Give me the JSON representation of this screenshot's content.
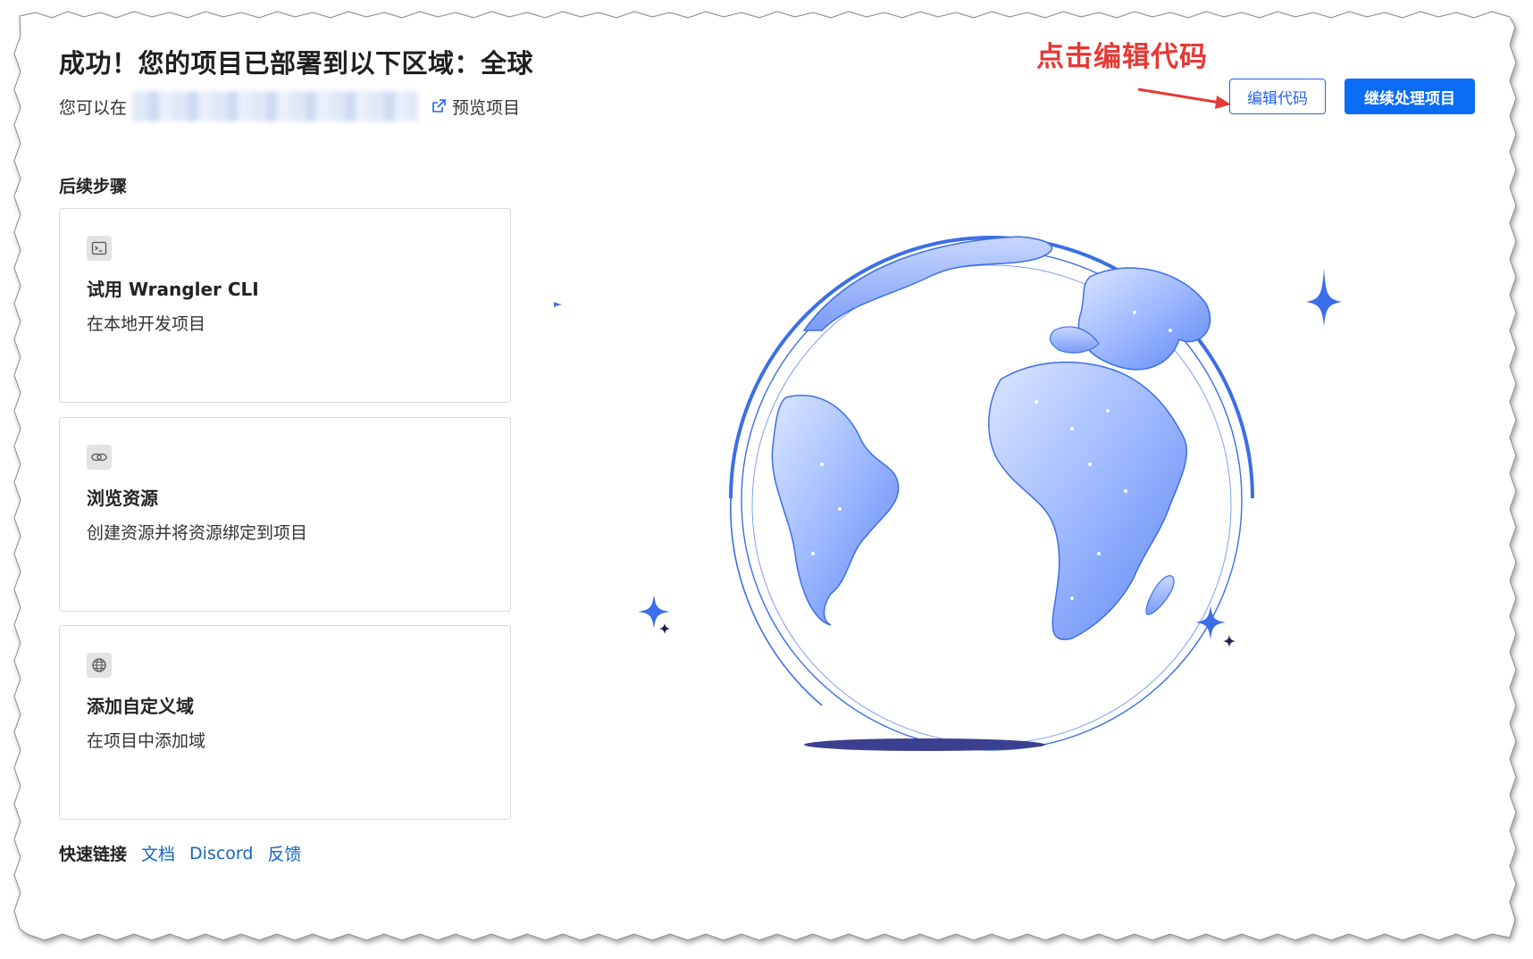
{
  "header": {
    "title": "成功！您的项目已部署到以下区域：全球",
    "subline_prefix": "您可以在",
    "preview_link": "预览项目"
  },
  "annotation": {
    "text": "点击编辑代码"
  },
  "actions": {
    "edit_code": "编辑代码",
    "continue": "继续处理项目"
  },
  "next_steps": {
    "title": "后续步骤",
    "cards": [
      {
        "icon": "terminal-icon",
        "title": "试用 Wrangler CLI",
        "desc": "在本地开发项目"
      },
      {
        "icon": "link-icon",
        "title": "浏览资源",
        "desc": "创建资源并将资源绑定到项目"
      },
      {
        "icon": "globe-icon",
        "title": "添加自定义域",
        "desc": "在项目中添加域"
      }
    ]
  },
  "quick_links": {
    "label": "快速链接",
    "links": [
      "文档",
      "Discord",
      "反馈"
    ]
  },
  "colors": {
    "accent": "#0a6cf5",
    "annotation": "#e53935",
    "globe_blue": "#3b6ee8"
  }
}
